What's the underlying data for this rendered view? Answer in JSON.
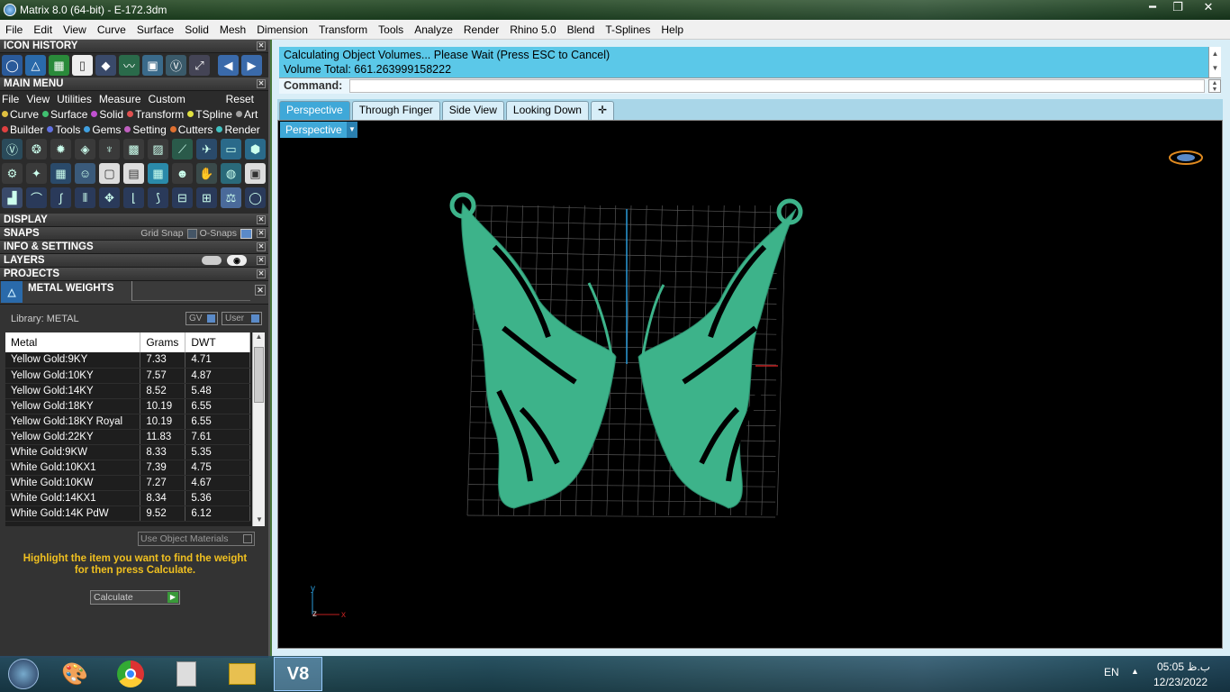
{
  "window": {
    "title": "Matrix 8.0 (64-bit) - E-172.3dm",
    "minimize": "━",
    "maximize": "❐",
    "close": "✕"
  },
  "menu": [
    "File",
    "Edit",
    "View",
    "Curve",
    "Surface",
    "Solid",
    "Mesh",
    "Dimension",
    "Transform",
    "Tools",
    "Analyze",
    "Render",
    "Rhino 5.0",
    "Blend",
    "T-Splines",
    "Help"
  ],
  "panels": {
    "icon_history": "ICON HISTORY",
    "main_menu": "MAIN MENU",
    "main_menu_items": [
      "File",
      "View",
      "Utilities",
      "Measure",
      "Custom"
    ],
    "reset": "Reset",
    "categories_row1": [
      {
        "label": "Curve",
        "color": "#e0c040"
      },
      {
        "label": "Surface",
        "color": "#40c070"
      },
      {
        "label": "Solid",
        "color": "#c050d0"
      },
      {
        "label": "Transform",
        "color": "#e05050"
      },
      {
        "label": "TSpline",
        "color": "#e0e040"
      },
      {
        "label": "Art",
        "color": "#a0a0a0"
      }
    ],
    "categories_row2": [
      {
        "label": "Builder",
        "color": "#e04040"
      },
      {
        "label": "Tools",
        "color": "#6070e0"
      },
      {
        "label": "Gems",
        "color": "#40a0e0"
      },
      {
        "label": "Setting",
        "color": "#c060c0"
      },
      {
        "label": "Cutters",
        "color": "#e07030"
      },
      {
        "label": "Render",
        "color": "#40c0c0"
      }
    ],
    "display": "DISPLAY",
    "snaps": "SNAPS",
    "grid_snap": "Grid Snap",
    "o_snaps": "O-Snaps",
    "info": "INFO & SETTINGS",
    "layers": "LAYERS",
    "projects": "PROJECTS",
    "metal_weights": "METAL WEIGHTS"
  },
  "metal": {
    "library": "Library: METAL",
    "gv": "GV",
    "user": "User",
    "columns": [
      "Metal",
      "Grams",
      "DWT"
    ],
    "rows": [
      [
        "Yellow Gold:9KY",
        "7.33",
        "4.71"
      ],
      [
        "Yellow Gold:10KY",
        "7.57",
        "4.87"
      ],
      [
        "Yellow Gold:14KY",
        "8.52",
        "5.48"
      ],
      [
        "Yellow Gold:18KY",
        "10.19",
        "6.55"
      ],
      [
        "Yellow Gold:18KY Royal",
        "10.19",
        "6.55"
      ],
      [
        "Yellow Gold:22KY",
        "11.83",
        "7.61"
      ],
      [
        "White Gold:9KW",
        "8.33",
        "5.35"
      ],
      [
        "White Gold:10KX1",
        "7.39",
        "4.75"
      ],
      [
        "White Gold:10KW",
        "7.27",
        "4.67"
      ],
      [
        "White Gold:14KX1",
        "8.34",
        "5.36"
      ],
      [
        "White Gold:14K PdW",
        "9.52",
        "6.12"
      ]
    ],
    "use_object_materials": "Use Object Materials",
    "hint": "Highlight the item you want to find the weight for then press Calculate.",
    "calculate": "Calculate"
  },
  "command": {
    "line1": "Calculating Object Volumes... Please Wait (Press ESC to Cancel)",
    "line2": "Volume Total: 661.263999158222",
    "label": "Command:",
    "value": ""
  },
  "viewport_tabs": [
    "Perspective",
    "Through Finger",
    "Side View",
    "Looking Down"
  ],
  "active_tab": "Perspective",
  "view_label": "Perspective",
  "axes": {
    "y": "y",
    "z": "z",
    "x": "x"
  },
  "model_color": "#3db38a",
  "taskbar": {
    "lang": "EN",
    "time": "05:05 ب.ظ",
    "date": "12/23/2022"
  }
}
